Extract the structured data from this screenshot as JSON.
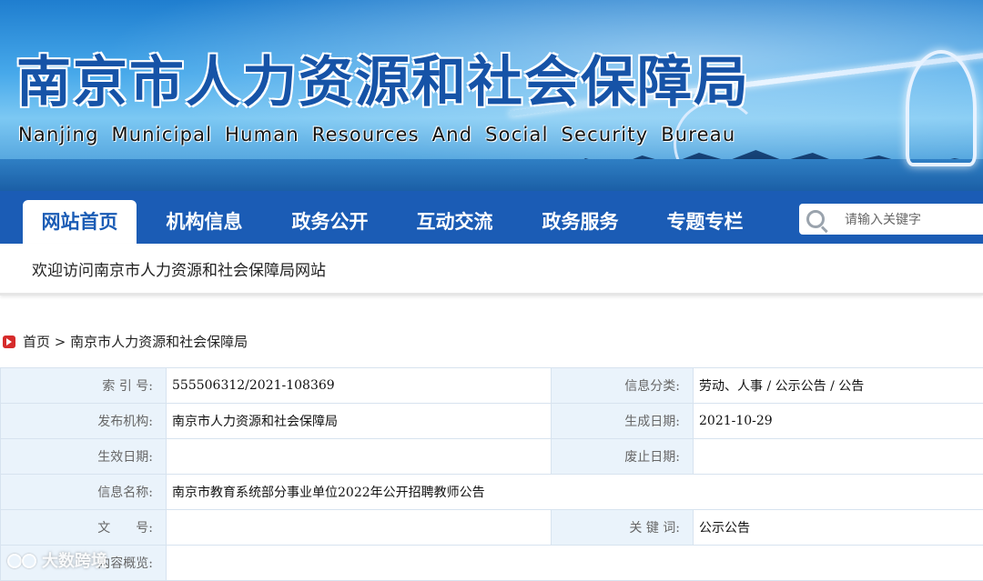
{
  "header": {
    "title_cn": "南京市人力资源和社会保障局",
    "title_en": "Nanjing Municipal Human Resources And Social Security Bureau"
  },
  "nav": {
    "items": [
      {
        "label": "网站首页",
        "active": true
      },
      {
        "label": "机构信息",
        "active": false
      },
      {
        "label": "政务公开",
        "active": false
      },
      {
        "label": "互动交流",
        "active": false
      },
      {
        "label": "政务服务",
        "active": false
      },
      {
        "label": "专题专栏",
        "active": false
      }
    ],
    "search_placeholder": "请输入关键字"
  },
  "welcome": {
    "text": "欢迎访问南京市人力资源和社会保障局网站"
  },
  "breadcrumb": {
    "home": "首页",
    "separator": " > ",
    "current": "南京市人力资源和社会保障局"
  },
  "info_table": {
    "index_label": "索 引 号:",
    "index_value": "555506312/2021-108369",
    "category_label": "信息分类:",
    "category_value": "劳动、人事 / 公示公告 / 公告",
    "publisher_label": "发布机构:",
    "publisher_value": "南京市人力资源和社会保障局",
    "created_label": "生成日期:",
    "created_value": "2021-10-29",
    "effective_label": "生效日期:",
    "effective_value": "",
    "expiry_label": "废止日期:",
    "expiry_value": "",
    "name_label": "信息名称:",
    "name_value": "南京市教育系统部分事业单位2022年公开招聘教师公告",
    "docno_label": "文　　号:",
    "docno_value": "",
    "keywords_label": "关 键 词:",
    "keywords_value": "公示公告",
    "preview_label": "内容概览:",
    "preview_value": ""
  },
  "watermark": {
    "text": "大数跨境"
  },
  "colors": {
    "nav_bg": "#1b5cb5",
    "label_bg": "#eaf3fb",
    "border": "#d7e3ef",
    "breadcrumb_icon": "#d62b2b"
  }
}
